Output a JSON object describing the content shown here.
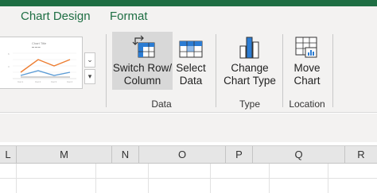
{
  "tabs": [
    {
      "label": "Chart Design",
      "active": true
    },
    {
      "label": "Format",
      "active": false
    }
  ],
  "chart_styles": {
    "thumbnail_title": "Chart Title",
    "thumbnail_legend": "▬ ▬ ▬",
    "more_icon": "▾",
    "scroll_down_icon": "⌄"
  },
  "data_group": {
    "label": "Data",
    "switch_row_column": {
      "line1": "Switch Row/",
      "line2": "Column"
    },
    "select_data": {
      "line1": "Select",
      "line2": "Data"
    }
  },
  "type_group": {
    "label": "Type",
    "change_chart_type": {
      "line1": "Change",
      "line2": "Chart Type"
    }
  },
  "location_group": {
    "label": "Location",
    "move_chart": {
      "line1": "Move",
      "line2": "Chart"
    }
  },
  "columns": [
    "L",
    "M",
    "N",
    "O",
    "P",
    "Q",
    "R"
  ],
  "colors": {
    "accent": "#1e6e43",
    "icon_blue": "#2b7cd3",
    "ribbon_bg": "#f3f2f1"
  }
}
